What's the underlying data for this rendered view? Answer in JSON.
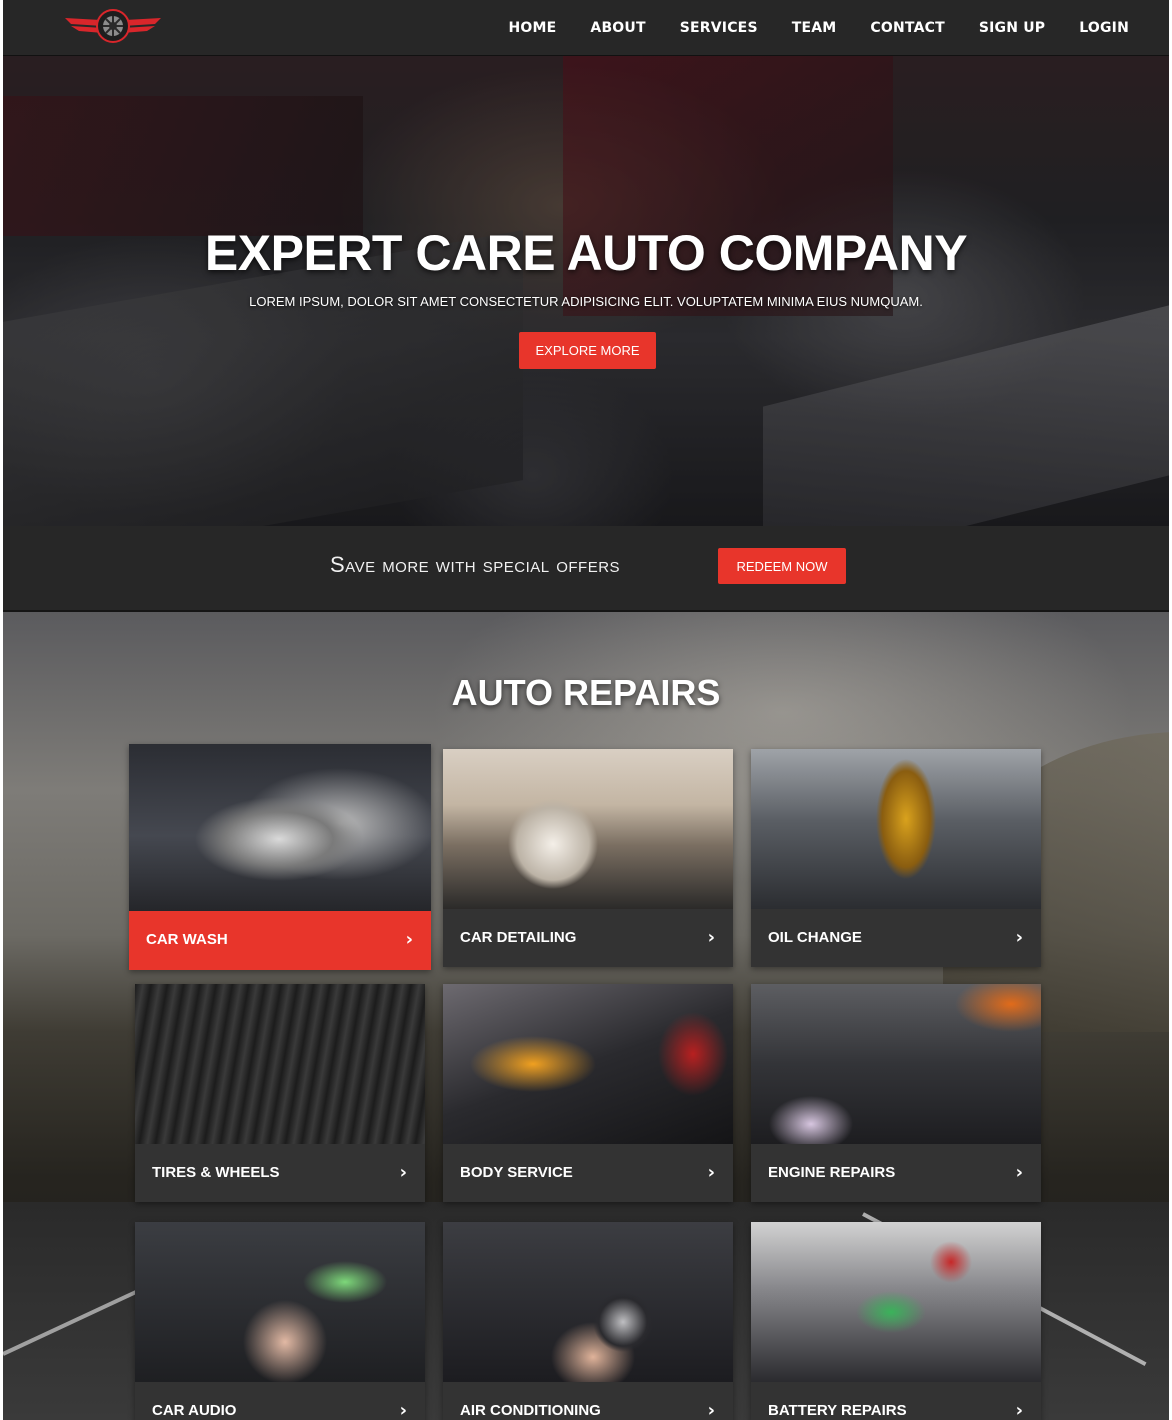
{
  "nav": {
    "items": [
      "HOME",
      "ABOUT",
      "SERVICES",
      "TEAM",
      "CONTACT",
      "SIGN UP",
      "LOGIN"
    ]
  },
  "hero": {
    "title": "EXPERT CARE AUTO COMPANY",
    "subtitle": "LOREM IPSUM, DOLOR SIT AMET CONSECTETUR ADIPISICING ELIT. VOLUPTATEM MINIMA EIUS NUMQUAM.",
    "button_label": "EXPLORE MORE"
  },
  "offers": {
    "text": "Save more with special offers",
    "button_label": "REDEEM NOW"
  },
  "repairs": {
    "title": "AUTO REPAIRS",
    "chevron": "›",
    "cards": [
      {
        "label": "CAR WASH",
        "image": "car-wash-photo",
        "active": true
      },
      {
        "label": "CAR DETAILING",
        "image": "car-interior-photo",
        "active": false
      },
      {
        "label": "OIL CHANGE",
        "image": "oil-pour-photo",
        "active": false
      },
      {
        "label": "TIRES & WHEELS",
        "image": "tires-photo",
        "active": false
      },
      {
        "label": "BODY SERVICE",
        "image": "car-polish-photo",
        "active": false
      },
      {
        "label": "ENGINE REPAIRS",
        "image": "engine-bay-photo",
        "active": false
      },
      {
        "label": "CAR AUDIO",
        "image": "car-stereo-photo",
        "active": false
      },
      {
        "label": "AIR CONDITIONING",
        "image": "ac-dial-photo",
        "active": false
      },
      {
        "label": "BATTERY REPAIRS",
        "image": "battery-charger-photo",
        "active": false
      }
    ]
  },
  "colors": {
    "accent": "#e8352b",
    "nav_bg": "#272727",
    "card_bar": "#333333"
  }
}
